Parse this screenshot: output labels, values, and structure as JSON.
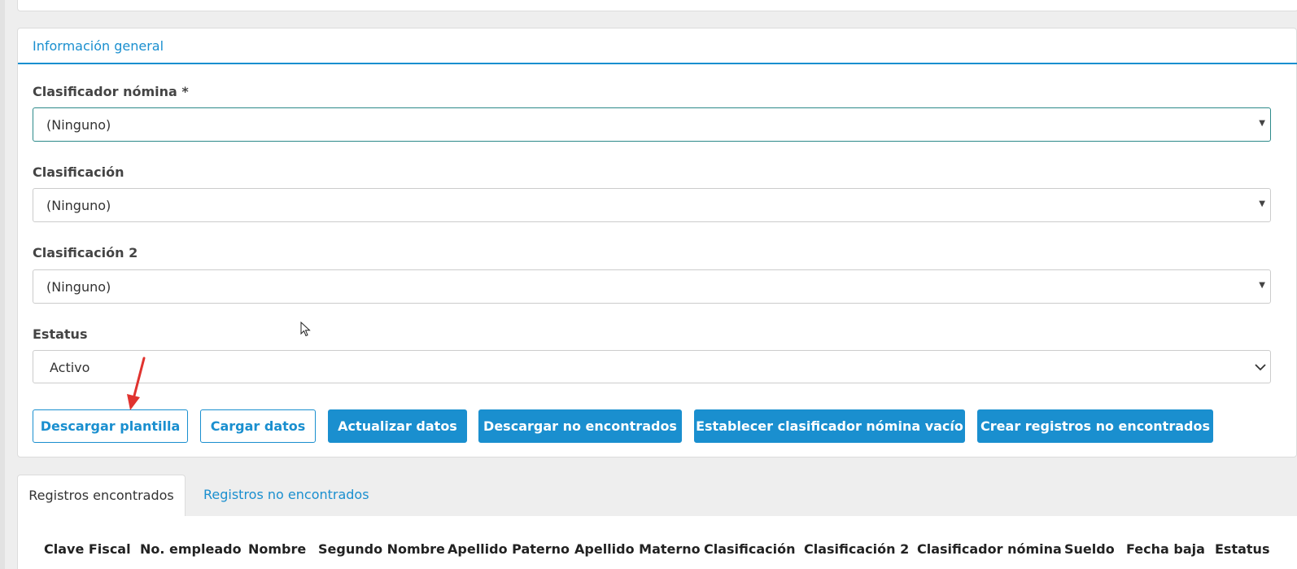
{
  "section": {
    "title": "Información general"
  },
  "fields": [
    {
      "label": "Clasificador nómina *",
      "value": "(Ninguno)"
    },
    {
      "label": "Clasificación",
      "value": "(Ninguno)"
    },
    {
      "label": "Clasificación 2",
      "value": "(Ninguno)"
    },
    {
      "label": "Estatus",
      "value": "Activo"
    }
  ],
  "buttons": {
    "download_template": "Descargar plantilla",
    "load_data": "Cargar datos",
    "update_data": "Actualizar datos",
    "download_not_found": "Descargar no encontrados",
    "set_empty_classifier": "Establecer clasificador nómina vacío",
    "create_not_found": "Crear registros no encontrados"
  },
  "tabs": [
    {
      "label": "Registros encontrados",
      "active": true
    },
    {
      "label": "Registros no encontrados",
      "active": false
    }
  ],
  "table": {
    "columns": [
      "Clave Fiscal",
      "No. empleado",
      "Nombre",
      "Segundo Nombre",
      "Apellido Paterno",
      "Apellido Materno",
      "Clasificación",
      "Clasificación 2",
      "Clasificador nómina",
      "Sueldo",
      "Fecha baja",
      "Estatus"
    ]
  },
  "colors": {
    "accent": "#1a8fcf",
    "focus_border": "#2d8a8a",
    "annotation": "#e0332f"
  },
  "icons": {
    "dropdown": "dropdown-triangle-icon",
    "chevron": "chevron-down-icon",
    "cursor": "mouse-pointer-icon",
    "annotation": "red-arrow-icon"
  }
}
